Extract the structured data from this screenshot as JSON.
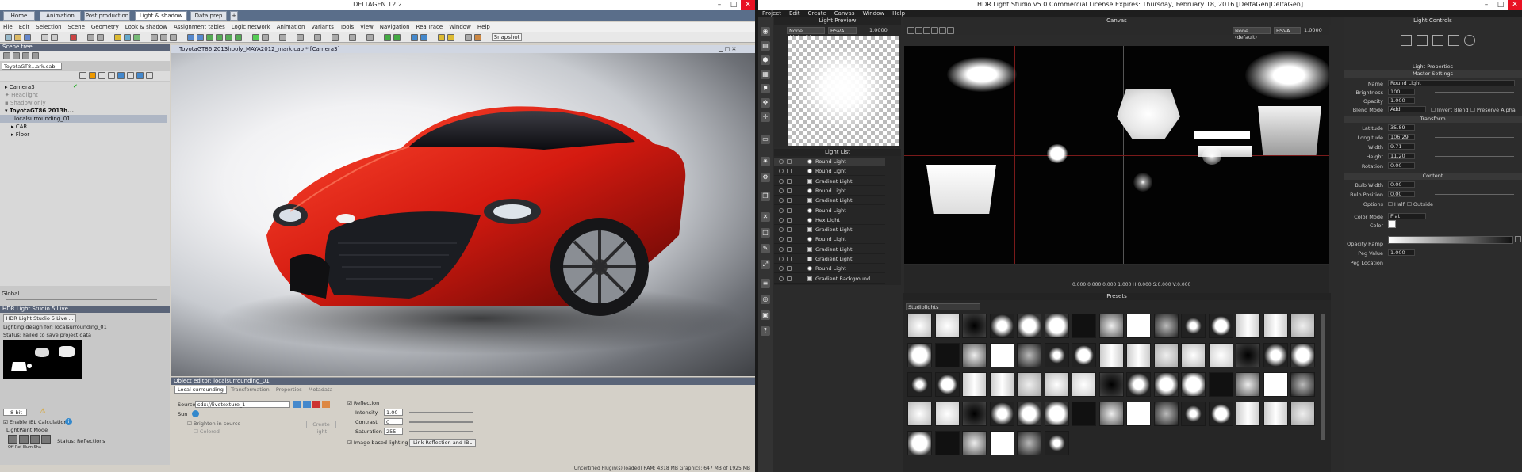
{
  "deltagen": {
    "title": "DELTAGEN 12.2",
    "tabs": [
      "Home",
      "Animation",
      "Post production",
      "Light & shadow",
      "Data prep"
    ],
    "active_tab": "Light & shadow",
    "menu": [
      "File",
      "Edit",
      "Selection",
      "Scene",
      "Geometry",
      "Look & shadow",
      "Assignment tables",
      "Logic network",
      "Animation",
      "Variants",
      "Tools",
      "View",
      "Navigation",
      "RealTrace",
      "Window",
      "Help"
    ],
    "snapshot_label": "Snapshot",
    "scene_tree": {
      "header": "Scene tree",
      "file_tab": "ToyotaGT8...ark.cab",
      "items": [
        "Camera3",
        "Headlight",
        "Shadow only",
        "ToyotaGT86 2013h...",
        "localsurrounding_01",
        "CAR",
        "Floor"
      ],
      "global_label": "Global"
    },
    "viewport_title": "ToyotaGT86 2013hpoly_MAYA2012_mark.cab * [Camera3]",
    "hls_live": {
      "header": "HDR Light Studio 5 Live",
      "button": "HDR Light Studio 5 Live ...",
      "lighting_for": "Lighting design for: localsurrounding_01",
      "status": "Status: Failed to save project data",
      "format_value": "8-bit",
      "enable_ibl": "Enable IBL Calculation",
      "lightpaint_mode": "LightPaint Mode",
      "lp_status": "Status: Reflections",
      "mode_icons": [
        "Off",
        "Ref",
        "Illum",
        "Sha"
      ]
    },
    "object_editor": {
      "header": "Object editor: localsurrounding_01",
      "tabs": [
        "Local surrounding",
        "Transformation",
        "Properties",
        "Metadata"
      ],
      "source_label": "Source",
      "source_value": "sdx://livetexture_1",
      "sun_label": "Sun",
      "brighten": "Brighten in source",
      "colored": "Colored",
      "create_light": "Create light",
      "reflection": "Reflection",
      "intensity_label": "Intensity",
      "intensity_value": "1.00",
      "contrast_label": "Contrast",
      "contrast_value": "0",
      "saturation_label": "Saturation",
      "saturation_value": "255",
      "ibl_label": "Image based lighting",
      "link_btn": "Link Reflection and IBL"
    },
    "status_bar": "[Uncertified Plugin(s) loaded]   RAM: 4318 MB Graphics: 647 MB of 1925 MB"
  },
  "hls": {
    "title": "HDR Light Studio v5.0 Commercial License Expires: Thursday, February 18, 2016   [DeltaGen|DeltaGen]",
    "menu": [
      "Project",
      "Edit",
      "Create",
      "Canvas",
      "Window",
      "Help"
    ],
    "light_preview": {
      "header": "Light Preview",
      "lut": "None (default)",
      "space": "HSVA",
      "exposure": "1.0000"
    },
    "canvas": {
      "header": "Canvas",
      "lut": "None (default)",
      "space": "HSVA",
      "exposure": "1.0000",
      "readout": "0.000 0.000 0.000  1.000",
      "readout2": "H:0.000 S:0.000 V:0.000"
    },
    "light_list": {
      "header": "Light List",
      "items": [
        "Round Light",
        "Round Light",
        "Gradient Light",
        "Round Light",
        "Gradient Light",
        "Round Light",
        "Hex Light",
        "Gradient Light",
        "Round Light",
        "Gradient Light",
        "Gradient Light",
        "Round Light",
        "Gradient Background"
      ]
    },
    "presets": {
      "header": "Presets",
      "category": "Studiolights"
    },
    "controls": {
      "header": "Light Controls",
      "props_header": "Light Properties",
      "master": "Master Settings",
      "name_label": "Name",
      "name_value": "Round Light",
      "brightness_label": "Brightness",
      "brightness_value": "100",
      "opacity_label": "Opacity",
      "opacity_value": "1.000",
      "blend_label": "Blend Mode",
      "blend_value": "Add",
      "invert_blend": "Invert Blend",
      "preserve_alpha": "Preserve Alpha",
      "transform": "Transform",
      "latitude_label": "Latitude",
      "latitude_value": "35.89",
      "longitude_label": "Longitude",
      "longitude_value": "106.29",
      "width_label": "Width",
      "width_value": "9.71",
      "height_label": "Height",
      "height_value": "11.20",
      "rotation_label": "Rotation",
      "rotation_value": "0.00",
      "content": "Content",
      "bulb_width_label": "Bulb Width",
      "bulb_width_value": "0.00",
      "bulb_pos_label": "Bulb Position",
      "bulb_pos_value": "0.00",
      "options_label": "Options",
      "half": "Half",
      "outside": "Outside",
      "color_mode_label": "Color Mode",
      "color_mode_value": "Flat",
      "color_label": "Color",
      "opacity_ramp_label": "Opacity Ramp",
      "peg_value_label": "Peg Value",
      "peg_value": "1.000",
      "peg_location_label": "Peg Location"
    }
  }
}
